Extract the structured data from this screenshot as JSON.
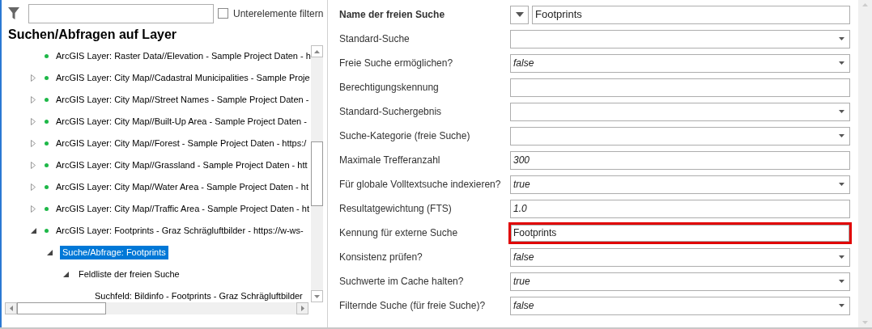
{
  "filter": {
    "subfilter": {
      "label": "Unterelemente filtern",
      "checked": false
    }
  },
  "tree": {
    "title": "Suchen/Abfragen auf Layer",
    "items": [
      {
        "label": "ArcGIS Layer: Raster Data//Elevation - Sample Project Daten - h",
        "kind": "layer",
        "has_children": false,
        "selected": false
      },
      {
        "label": "ArcGIS Layer: City Map//Cadastral Municipalities - Sample Proje",
        "kind": "layer",
        "has_children": true,
        "expanded": false,
        "selected": false
      },
      {
        "label": "ArcGIS Layer: City Map//Street Names - Sample Project Daten -",
        "kind": "layer",
        "has_children": true,
        "expanded": false,
        "selected": false
      },
      {
        "label": "ArcGIS Layer: City Map//Built-Up Area - Sample Project Daten -",
        "kind": "layer",
        "has_children": true,
        "expanded": false,
        "selected": false
      },
      {
        "label": "ArcGIS Layer: City Map//Forest - Sample Project Daten - https:/",
        "kind": "layer",
        "has_children": true,
        "expanded": false,
        "selected": false
      },
      {
        "label": "ArcGIS Layer: City Map//Grassland - Sample Project Daten - htt",
        "kind": "layer",
        "has_children": true,
        "expanded": false,
        "selected": false
      },
      {
        "label": "ArcGIS Layer: City Map//Water Area - Sample Project Daten - ht",
        "kind": "layer",
        "has_children": true,
        "expanded": false,
        "selected": false
      },
      {
        "label": "ArcGIS Layer: City Map//Traffic Area - Sample Project Daten - ht",
        "kind": "layer",
        "has_children": true,
        "expanded": false,
        "selected": false
      },
      {
        "label": "ArcGIS Layer: Footprints - Graz Schrägluftbilder - https://w-ws-",
        "kind": "layer",
        "has_children": true,
        "expanded": true,
        "selected": false,
        "children": [
          {
            "label": "Suche/Abfrage: Footprints",
            "kind": "node",
            "has_children": true,
            "expanded": true,
            "selected": true,
            "children": [
              {
                "label": "Feldliste der freien Suche",
                "kind": "node",
                "has_children": true,
                "expanded": true,
                "selected": false,
                "children": [
                  {
                    "label": "Suchfeld: Bildinfo - Footprints - Graz Schrägluftbilder",
                    "kind": "node",
                    "has_children": false,
                    "selected": false
                  }
                ]
              }
            ]
          }
        ]
      }
    ]
  },
  "properties": [
    {
      "label": "Name der freien Suche",
      "kind": "name",
      "value": "Footprints",
      "is_default": false,
      "highlighted": false
    },
    {
      "label": "Standard-Suche",
      "kind": "combo",
      "highlighted": false
    },
    {
      "label": "Freie Suche ermöglichen?",
      "kind": "combo",
      "value": "false",
      "is_default": true,
      "highlighted": false
    },
    {
      "label": "Berechtigungskennung",
      "kind": "text",
      "highlighted": false
    },
    {
      "label": "Standard-Suchergebnis",
      "kind": "combo",
      "highlighted": false
    },
    {
      "label": "Suche-Kategorie (freie Suche)",
      "kind": "combo",
      "highlighted": false
    },
    {
      "label": "Maximale Trefferanzahl",
      "kind": "text",
      "value": "300",
      "is_default": true,
      "highlighted": false
    },
    {
      "label": "Für globale Volltextsuche indexieren?",
      "kind": "combo",
      "value": "true",
      "is_default": true,
      "highlighted": false
    },
    {
      "label": "Resultatgewichtung (FTS)",
      "kind": "text",
      "value": "1.0",
      "is_default": true,
      "highlighted": false
    },
    {
      "label": "Kennung für externe Suche",
      "kind": "text",
      "value": "Footprints",
      "is_default": false,
      "highlighted": true
    },
    {
      "label": "Konsistenz prüfen?",
      "kind": "combo",
      "value": "false",
      "is_default": true,
      "highlighted": false
    },
    {
      "label": "Suchwerte im Cache halten?",
      "kind": "combo",
      "value": "true",
      "is_default": true,
      "highlighted": false
    },
    {
      "label": "Filternde Suche (für freie Suche)?",
      "kind": "combo",
      "value": "false",
      "is_default": true,
      "highlighted": false
    }
  ]
}
